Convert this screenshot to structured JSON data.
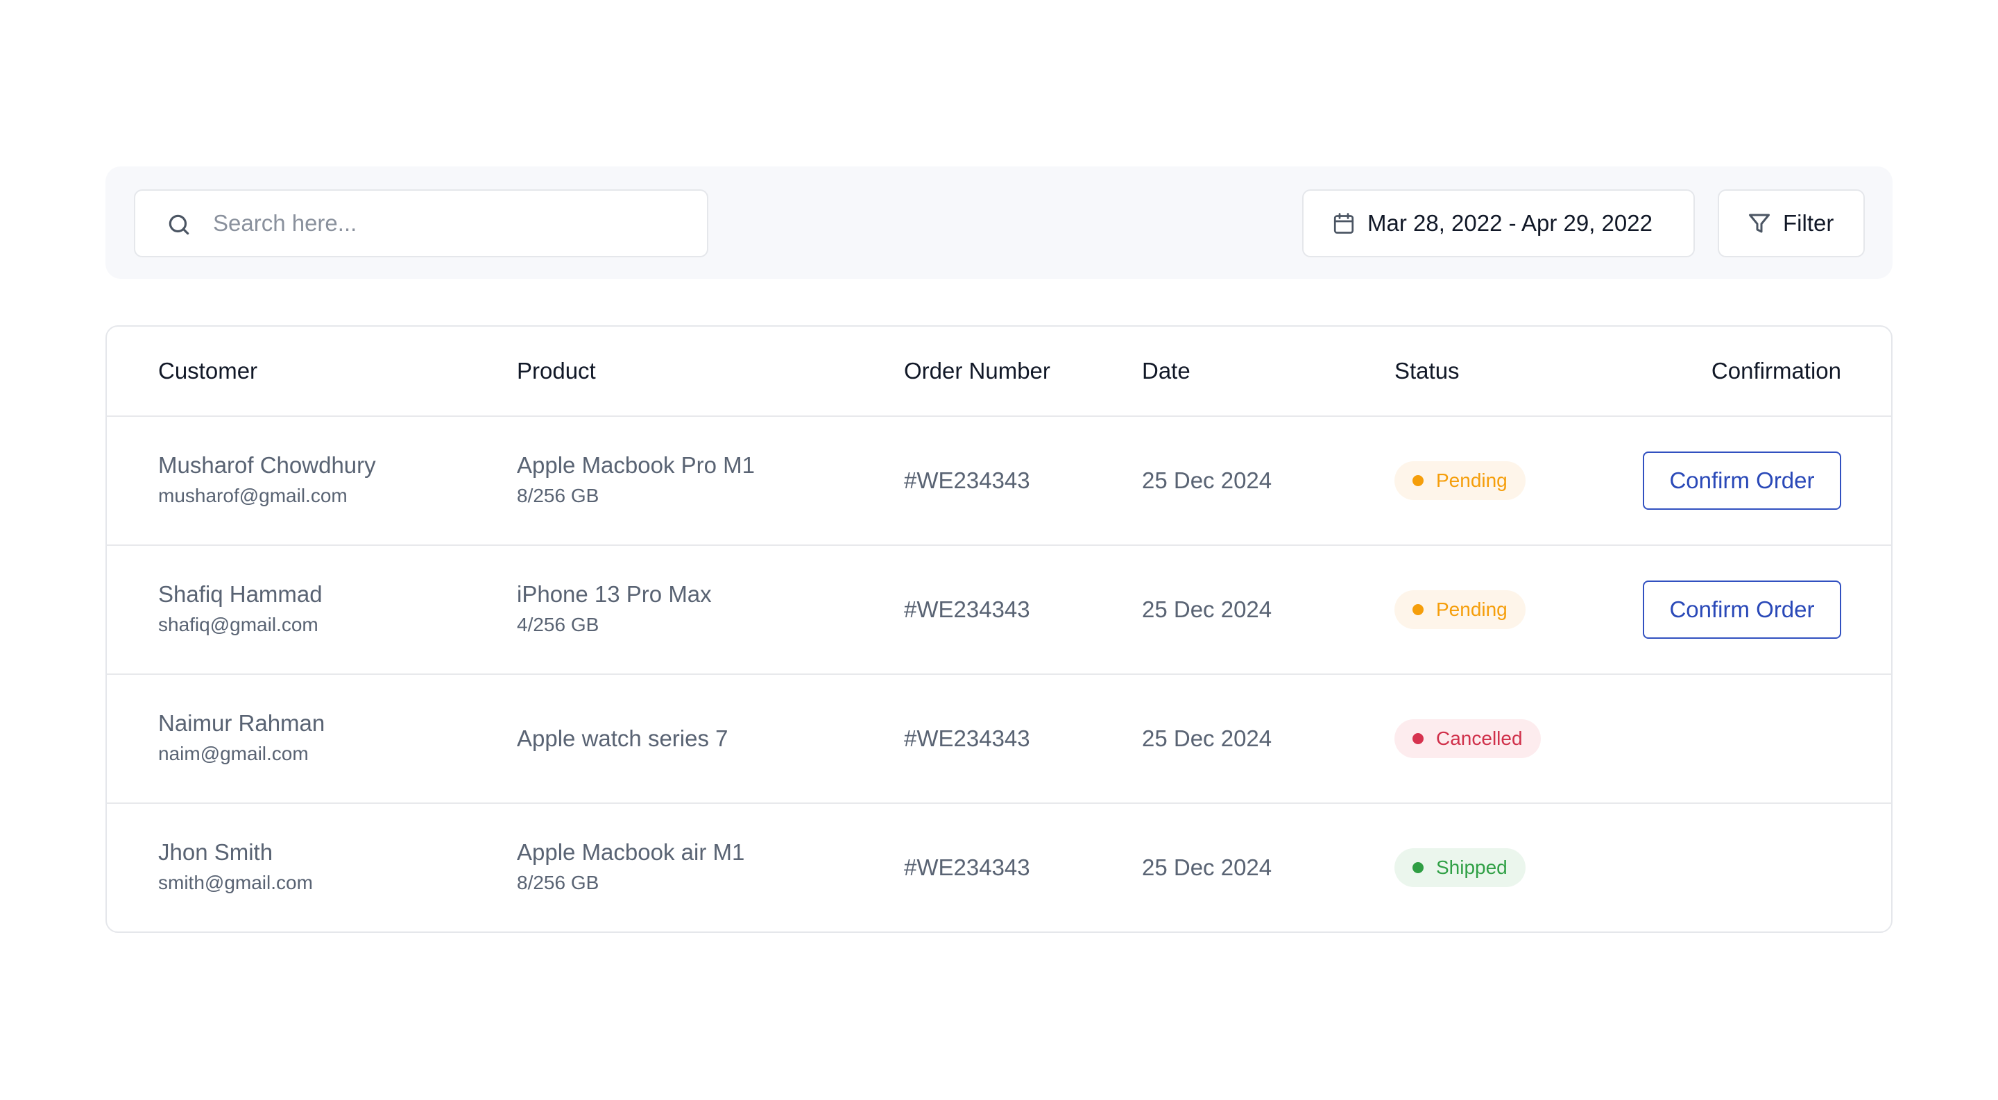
{
  "toolbar": {
    "search": {
      "placeholder": "Search here...",
      "value": "",
      "icon": "search-icon"
    },
    "date_range": {
      "label": "Mar 28, 2022 - Apr 29, 2022",
      "icon": "calendar-icon"
    },
    "filter": {
      "label": "Filter",
      "icon": "filter-icon"
    }
  },
  "table": {
    "columns": [
      "Customer",
      "Product",
      "Order Number",
      "Date",
      "Status",
      "Confirmation"
    ],
    "rows": [
      {
        "customer_name": "Musharof Chowdhury",
        "customer_email": "musharof@gmail.com",
        "product_name": "Apple Macbook Pro M1",
        "product_spec": "8/256 GB",
        "order_number": "#WE234343",
        "date": "25 Dec 2024",
        "status": "Pending",
        "action": "Confirm Order"
      },
      {
        "customer_name": "Shafiq Hammad",
        "customer_email": "shafiq@gmail.com",
        "product_name": "iPhone 13 Pro Max",
        "product_spec": "4/256 GB",
        "order_number": "#WE234343",
        "date": "25 Dec 2024",
        "status": "Pending",
        "action": "Confirm Order"
      },
      {
        "customer_name": "Naimur Rahman",
        "customer_email": "naim@gmail.com",
        "product_name": "Apple watch series 7",
        "product_spec": "",
        "order_number": "#WE234343",
        "date": "25 Dec 2024",
        "status": "Cancelled",
        "action": ""
      },
      {
        "customer_name": "Jhon Smith",
        "customer_email": "smith@gmail.com",
        "product_name": "Apple Macbook air M1",
        "product_spec": "8/256 GB",
        "order_number": "#WE234343",
        "date": "25 Dec 2024",
        "status": "Shipped",
        "action": ""
      }
    ]
  },
  "status_colors": {
    "Pending": {
      "text": "#f59e0b",
      "bg": "#fef5ea",
      "dot": "#f59e0b"
    },
    "Cancelled": {
      "text": "#d0304a",
      "bg": "#fdecee",
      "dot": "#d6334f"
    },
    "Shipped": {
      "text": "#30a046",
      "bg": "#ebf6ed",
      "dot": "#2f9e44"
    }
  },
  "accent_color": "#2a49b8"
}
